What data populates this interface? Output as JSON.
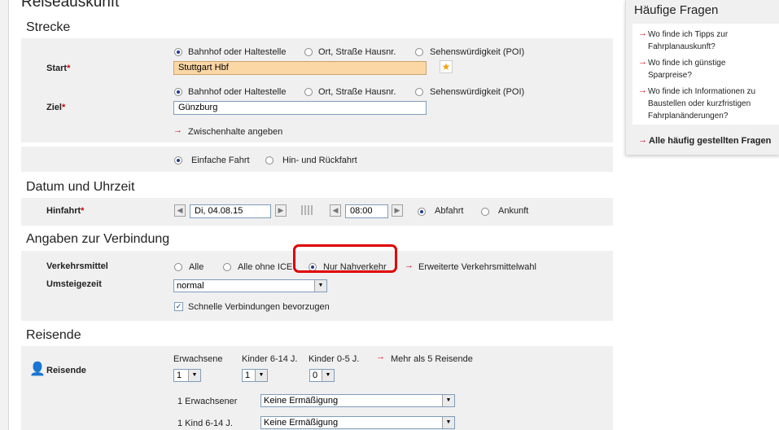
{
  "page_title": "Reiseauskunft",
  "sections": {
    "strecke": "Strecke",
    "datum": "Datum und Uhrzeit",
    "verbindung": "Angaben zur Verbindung",
    "reisende": "Reisende"
  },
  "start": {
    "label": "Start",
    "options": [
      "Bahnhof oder Haltestelle",
      "Ort, Straße Hausnr.",
      "Sehenswürdigkeit (POI)"
    ],
    "value": "Stuttgart Hbf"
  },
  "ziel": {
    "label": "Ziel",
    "options": [
      "Bahnhof oder Haltestelle",
      "Ort, Straße Hausnr.",
      "Sehenswürdigkeit (POI)"
    ],
    "value": "Günzburg"
  },
  "req_mark": "*",
  "zwischenhalte": "Zwischenhalte angeben",
  "trip": {
    "einfach": "Einfache Fahrt",
    "hinrueck": "Hin- und Rückfahrt"
  },
  "hinfahrt": {
    "label": "Hinfahrt",
    "date": "Di, 04.08.15",
    "time": "08:00",
    "abfahrt": "Abfahrt",
    "ankunft": "Ankunft"
  },
  "verkehrsmittel": {
    "label": "Verkehrsmittel",
    "alle": "Alle",
    "ohne_ice": "Alle ohne ICE",
    "nahverkehr": "Nur Nahverkehr",
    "erweitert": "Erweiterte Verkehrsmittelwahl"
  },
  "umsteigezeit": {
    "label": "Umsteigezeit",
    "value": "normal"
  },
  "schnelle": "Schnelle Verbindungen bevorzugen",
  "reisende": {
    "label": "Reisende",
    "erwachsene": "Erwachsene",
    "kinder614": "Kinder 6-14 J.",
    "kinder05": "Kinder 0-5 J.",
    "mehr": "Mehr als 5 Reisende",
    "erw_count": "1",
    "k614_count": "1",
    "k05_count": "0",
    "row1_label": "1 Erwachsener",
    "row1_value": "Keine Ermäßigung",
    "row2_label": "1 Kind 6-14 J.",
    "row2_value": "Keine Ermäßigung"
  },
  "faq": {
    "title": "Häufige Fragen",
    "items": [
      "Wo finde ich Tipps zur Fahrplanauskunft?",
      "Wo finde ich günstige Sparpreise?",
      "Wo finde ich Informationen zu Baustellen oder kurzfristigen Fahrplanänderungen?"
    ],
    "all": "Alle häufig gestellten Fragen"
  },
  "colors": {
    "accent": "#d6001c",
    "highlight_input": "#fbd7a5",
    "annotation": "#e00000"
  }
}
